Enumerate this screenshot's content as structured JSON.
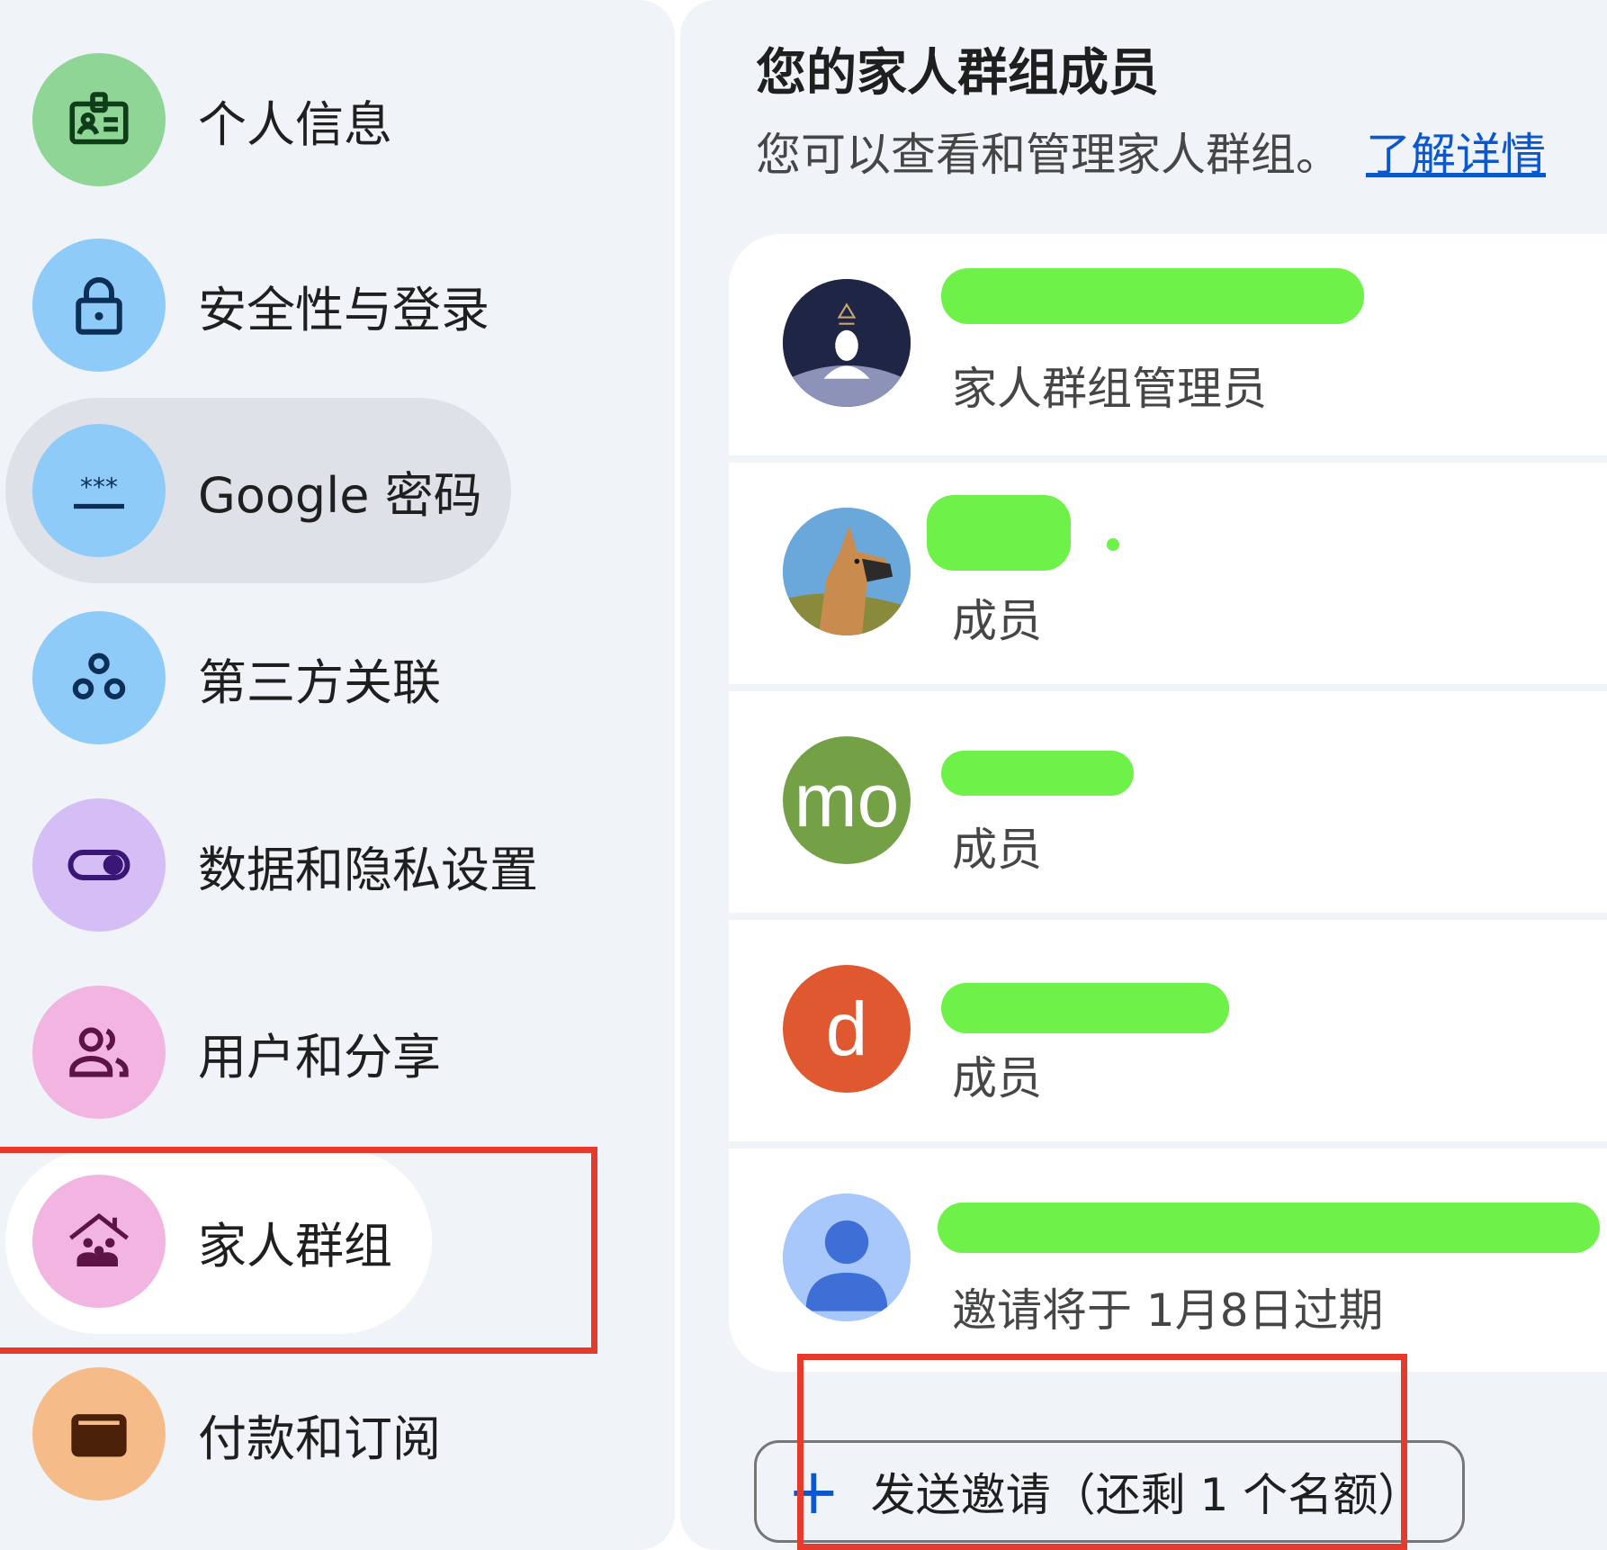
{
  "nav": {
    "items": [
      {
        "label": "个人信息",
        "icon": "id-card-icon",
        "color": "#8fd595"
      },
      {
        "label": "安全性与登录",
        "icon": "lock-icon",
        "color": "#8ecbf8"
      },
      {
        "label": "Google 密码",
        "icon": "password-icon",
        "color": "#8ecbf8"
      },
      {
        "label": "第三方关联",
        "icon": "connections-icon",
        "color": "#8ecbf8"
      },
      {
        "label": "数据和隐私设置",
        "icon": "toggle-icon",
        "color": "#d5bdf5"
      },
      {
        "label": "用户和分享",
        "icon": "people-icon",
        "color": "#f2b4e0"
      },
      {
        "label": "家人群组",
        "icon": "family-home-icon",
        "color": "#f2b4e0"
      },
      {
        "label": "付款和订阅",
        "icon": "wallet-icon",
        "color": "#f5bc8a"
      }
    ],
    "active_index": 2,
    "current_index": 6
  },
  "main": {
    "title": "您的家人群组成员",
    "subtitle": "您可以查看和管理家人群组。",
    "learn_more": "了解详情",
    "members": [
      {
        "role": "家人群组管理员",
        "avatar": "image",
        "avatar_icon": "astronaut-avatar-icon"
      },
      {
        "role": "成员",
        "avatar": "image",
        "avatar_icon": "dog-avatar-icon"
      },
      {
        "role": "成员",
        "avatar": "letter",
        "letter": "mo",
        "color": "#74a145"
      },
      {
        "role": "成员",
        "avatar": "letter",
        "letter": "d",
        "color": "#e0582f"
      },
      {
        "role": "邀请将于 1月8日过期",
        "avatar": "placeholder",
        "avatar_icon": "person-placeholder-icon"
      }
    ],
    "invite_button": "发送邀请（还剩 1 个名额）"
  },
  "colors": {
    "accent": "#0b57d0",
    "highlight_border": "#e53b2c",
    "redaction": "#6ef24a"
  }
}
